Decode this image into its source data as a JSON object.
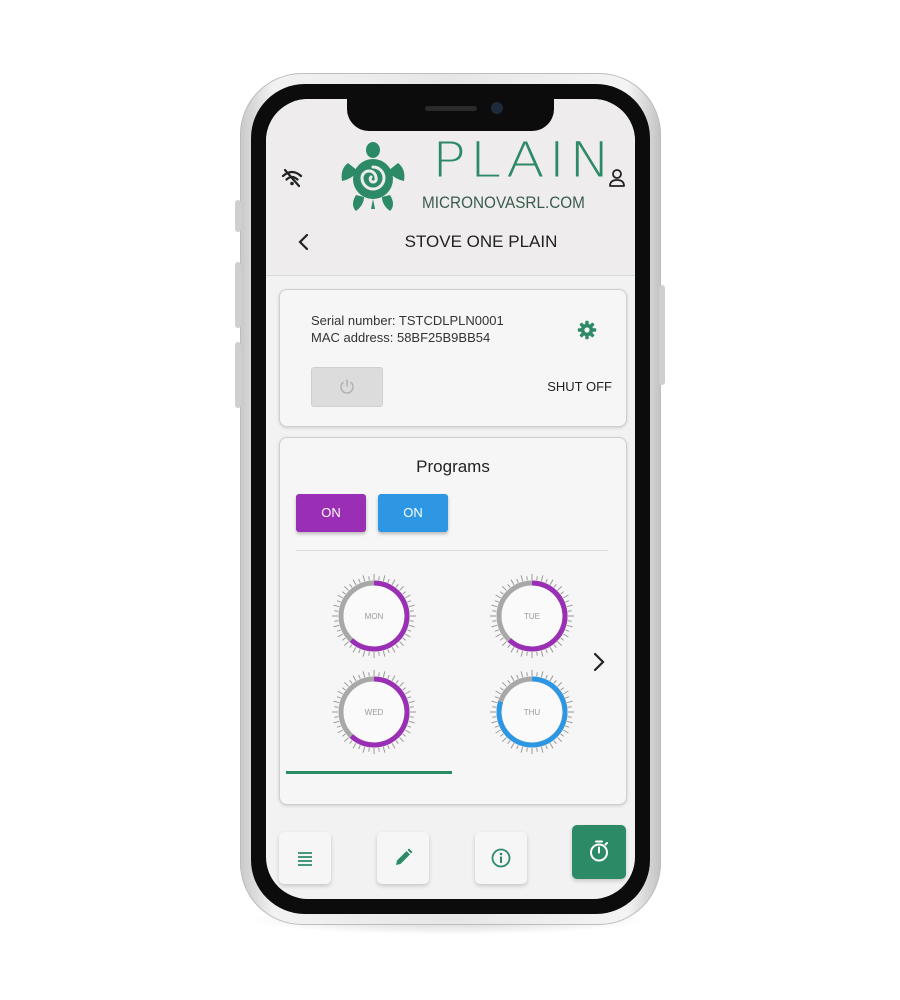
{
  "brand": {
    "name": "PLAIN",
    "website": "MICRONOVASRL.COM"
  },
  "header": {
    "title": "STOVE ONE PLAIN"
  },
  "device": {
    "serial_number": "Serial number: TSTCDLPLN0001",
    "mac_address": "MAC address: 58BF25B9BB54",
    "status": "SHUT OFF"
  },
  "programs": {
    "title": "Programs",
    "toggle_1": "ON",
    "toggle_2": "ON",
    "days": [
      {
        "label": "MON",
        "fill": 0.62,
        "color": "#9a2fb5"
      },
      {
        "label": "TUE",
        "fill": 0.62,
        "color": "#9a2fb5"
      },
      {
        "label": "WED",
        "fill": 0.62,
        "color": "#9a2fb5"
      },
      {
        "label": "THU",
        "fill": 0.8,
        "color": "#2e97e3"
      }
    ]
  },
  "icons": [
    "wifi-off-icon",
    "user-icon",
    "turtle-logo",
    "back-chevron-icon",
    "gear-icon",
    "power-icon",
    "next-chevron-icon",
    "list-icon",
    "pencil-icon",
    "info-icon",
    "timer-icon"
  ],
  "colors": {
    "accent": "#2d8a66",
    "purple": "#9a2fb5",
    "blue": "#2e97e3"
  }
}
